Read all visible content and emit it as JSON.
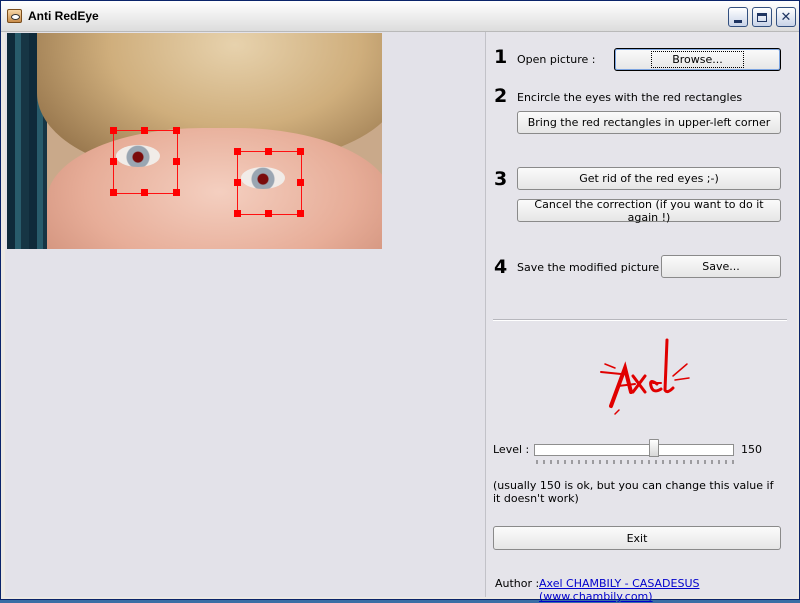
{
  "window": {
    "title": "Anti RedEye",
    "icon": "eye-app-icon",
    "controls": [
      "minimize-icon",
      "maximize-icon",
      "close-icon"
    ]
  },
  "steps": {
    "step1": {
      "number": "1",
      "label": "Open picture :",
      "button": "Browse..."
    },
    "step2": {
      "number": "2",
      "label": "Encircle the eyes with the red rectangles",
      "button": "Bring the red rectangles in upper-left corner"
    },
    "step3": {
      "number": "3",
      "button_fix": "Get rid of the red eyes ;-)",
      "button_cancel": "Cancel the correction (if you want to do it again !)"
    },
    "step4": {
      "number": "4",
      "label": "Save the modified picture :",
      "button": "Save..."
    }
  },
  "level": {
    "label": "Level :",
    "value": "150",
    "fraction": 0.6,
    "hint": "(usually 150 is ok, but you can change this value if it doesn't work)"
  },
  "exit_button": "Exit",
  "author": {
    "label": "Author :",
    "link": "Axel CHAMBILY - CASADESUS (www.chambily.com)"
  },
  "logo_text": "Axel",
  "colors": {
    "selection": "#ff0000",
    "logo": "#e00000",
    "link": "#0000cc"
  }
}
